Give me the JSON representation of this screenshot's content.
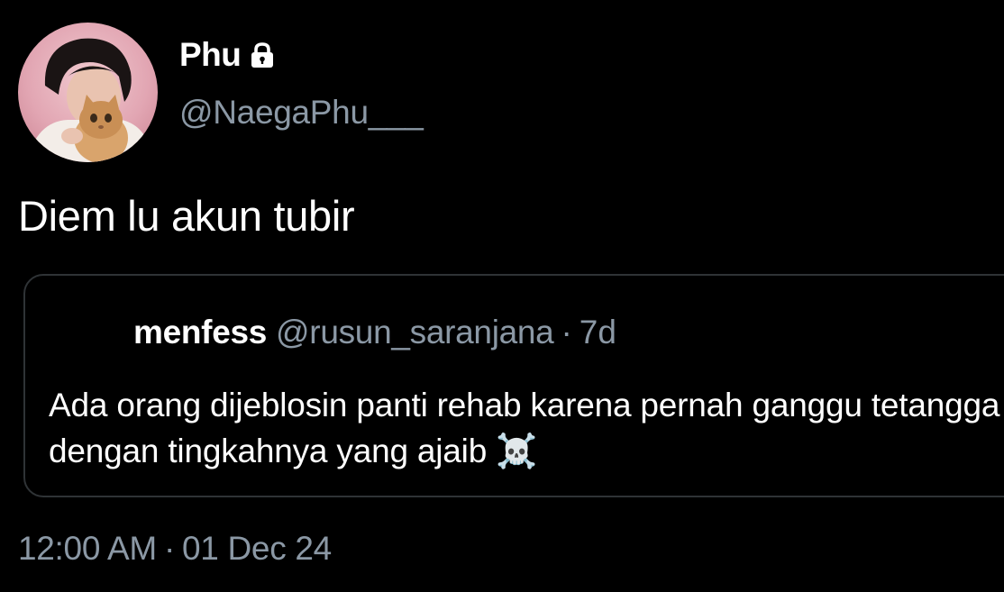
{
  "author": {
    "display_name": "Phu",
    "handle": "@NaegaPhu___",
    "protected_icon": "lock-icon"
  },
  "tweet": {
    "text": "Diem lu akun tubir"
  },
  "quoted_tweet": {
    "name": "menfess",
    "handle": "@rusun_saranjana",
    "separator": "·",
    "time": "7d",
    "text": "Ada orang dijeblosin panti rehab karena pernah ganggu tetangga dengan tingkahnya yang ajaib ☠️"
  },
  "meta": {
    "time": "12:00 AM",
    "separator": "·",
    "date": "01 Dec 24"
  },
  "colors": {
    "background": "#000000",
    "primary_text": "#ffffff",
    "secondary_text": "#8b98a5",
    "border": "#2f3336"
  }
}
